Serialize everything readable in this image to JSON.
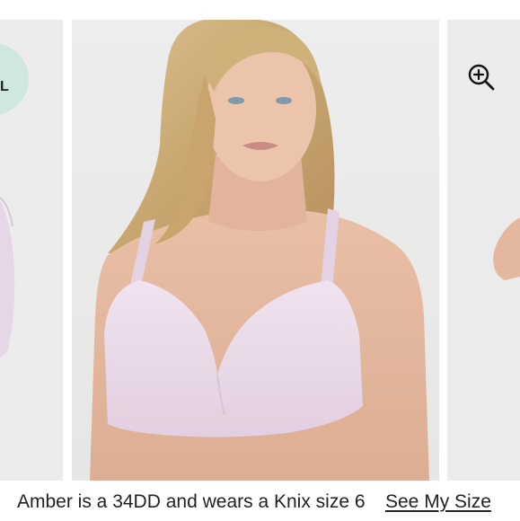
{
  "gallery": {
    "badge_text": "L",
    "zoom_icon": "zoom-in-icon",
    "main_image_alt": "Model wearing a lilac wireless bra",
    "prev_image_alt": "Previous product image",
    "next_image_alt": "Next product image"
  },
  "caption": {
    "model_info": "Amber is a 34DD and wears a Knix size 6",
    "size_link": "See My Size"
  },
  "colors": {
    "badge": "#cfe7dc",
    "bra": "#e9d9e8",
    "text": "#222222"
  }
}
